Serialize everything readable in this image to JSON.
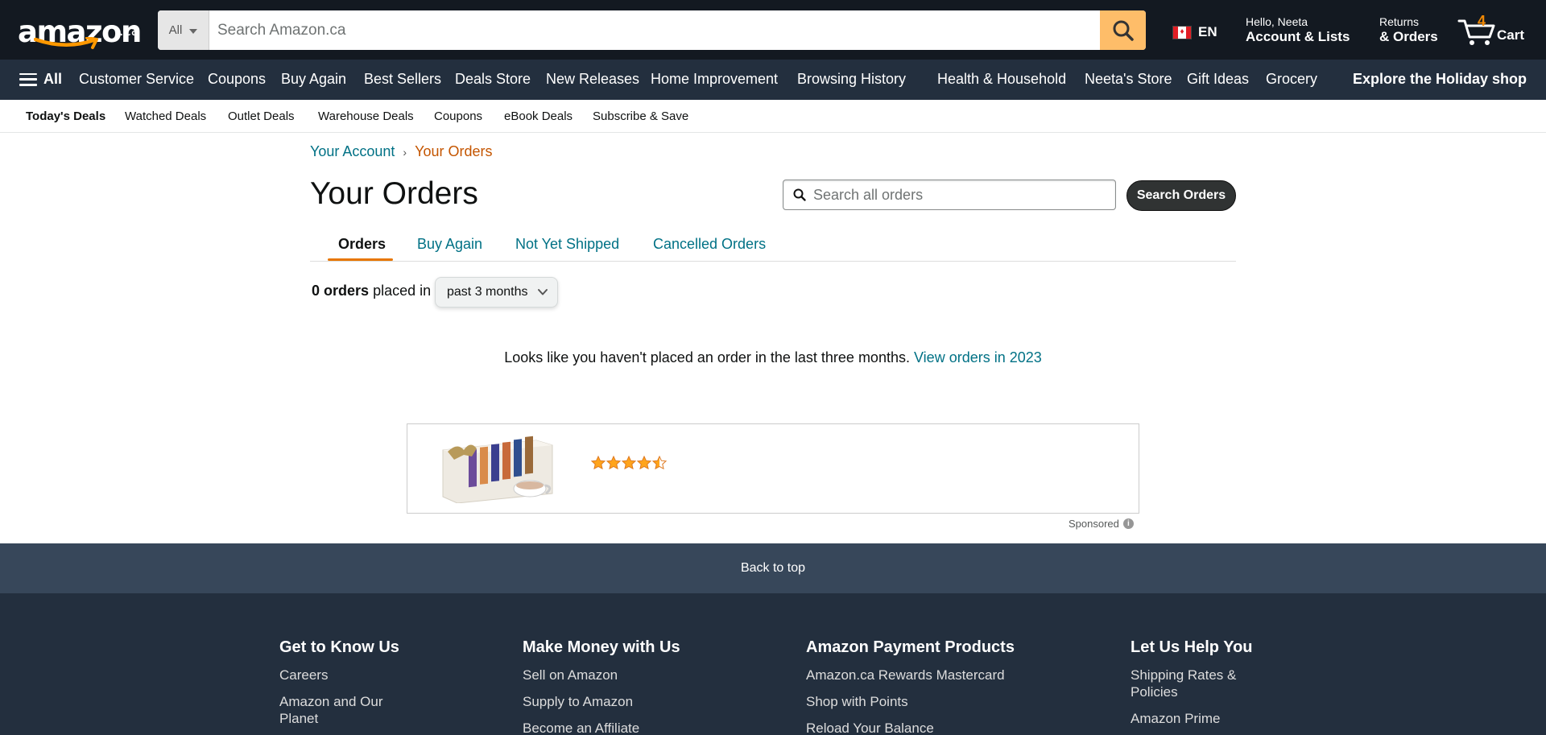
{
  "nav": {
    "logo_text": "amazon",
    "logo_tld": ".ca",
    "search_category": "All",
    "search_placeholder": "Search Amazon.ca",
    "language": "EN",
    "account_greeting": "Hello, Neeta",
    "account_label": "Account & Lists",
    "returns_line1": "Returns",
    "returns_line2": "& Orders",
    "cart_count": "4",
    "cart_label": "Cart"
  },
  "subnav": {
    "all_label": "All",
    "items": [
      "Customer Service",
      "Coupons",
      "Buy Again",
      "Best Sellers",
      "Deals Store",
      "New Releases",
      "Home Improvement",
      "Browsing History",
      "Health & Household",
      "Neeta's Store",
      "Gift Ideas",
      "Grocery"
    ],
    "promo": "Explore the Holiday shop"
  },
  "deals_bar": {
    "items": [
      "Today's Deals",
      "Watched Deals",
      "Outlet Deals",
      "Warehouse Deals",
      "Coupons",
      "eBook Deals",
      "Subscribe & Save"
    ]
  },
  "breadcrumb": {
    "parent": "Your Account",
    "separator": "›",
    "current": "Your Orders"
  },
  "page": {
    "title": "Your Orders",
    "search_placeholder": "Search all orders",
    "search_button": "Search Orders"
  },
  "tabs": [
    "Orders",
    "Buy Again",
    "Not Yet Shipped",
    "Cancelled Orders"
  ],
  "orders": {
    "count": "0 orders",
    "placed_in": "placed in",
    "period": "past 3 months",
    "empty_message": "Looks like you haven't placed an order in the last three months.",
    "view_link": "View orders in 2023"
  },
  "ad": {
    "rating": 4.5,
    "sponsored_label": "Sponsored"
  },
  "footer": {
    "back_to_top": "Back to top",
    "columns": [
      {
        "title": "Get to Know Us",
        "links": [
          "Careers",
          "Amazon and Our Planet"
        ]
      },
      {
        "title": "Make Money with Us",
        "links": [
          "Sell on Amazon",
          "Supply to Amazon",
          "Become an Affiliate"
        ]
      },
      {
        "title": "Amazon Payment Products",
        "links": [
          "Amazon.ca Rewards Mastercard",
          "Shop with Points",
          "Reload Your Balance"
        ]
      },
      {
        "title": "Let Us Help You",
        "links": [
          "Shipping Rates & Policies",
          "Amazon Prime"
        ]
      }
    ]
  },
  "colors": {
    "nav_bg": "#131921",
    "subnav_bg": "#232f3e",
    "search_button": "#febd69",
    "link": "#007185",
    "breadcrumb_current": "#c45500",
    "tab_underline": "#e77600",
    "star": "#ffa41c"
  }
}
